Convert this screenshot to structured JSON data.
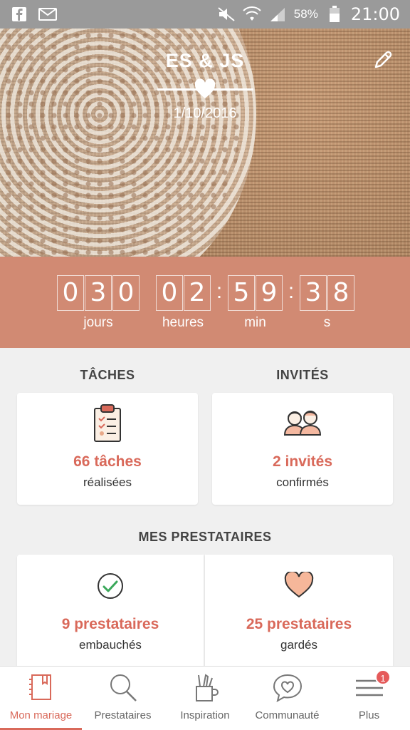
{
  "status_bar": {
    "battery_percent": "58%",
    "time": "21:00"
  },
  "header": {
    "couple_names": "ES & JS",
    "wedding_date": "1/10/2016"
  },
  "countdown": {
    "days_digits": [
      "0",
      "3",
      "0"
    ],
    "hours_digits": [
      "0",
      "2"
    ],
    "minutes_digits": [
      "5",
      "9"
    ],
    "seconds_digits": [
      "3",
      "8"
    ],
    "separator": ":",
    "labels": {
      "days": "jours",
      "hours": "heures",
      "minutes": "min",
      "seconds": "s"
    }
  },
  "tasks": {
    "title": "TÂCHES",
    "value": "66 tâches",
    "sub": "réalisées"
  },
  "guests": {
    "title": "INVITÉS",
    "value": "2 invités",
    "sub": "confirmés"
  },
  "vendors": {
    "title": "MES PRESTATAIRES",
    "hired": {
      "value": "9 prestataires",
      "sub": "embauchés"
    },
    "saved": {
      "value": "25 prestataires",
      "sub": "gardés"
    }
  },
  "bottom_nav": {
    "items": [
      {
        "label": "Mon mariage",
        "icon": "notebook-icon",
        "active": true
      },
      {
        "label": "Prestataires",
        "icon": "search-icon"
      },
      {
        "label": "Inspiration",
        "icon": "pencil-cup-icon"
      },
      {
        "label": "Communauté",
        "icon": "chat-heart-icon"
      },
      {
        "label": "Plus",
        "icon": "menu-icon",
        "badge": "1"
      }
    ]
  },
  "colors": {
    "accent": "#d9695a",
    "countdown_bg": "#d18a73",
    "status_bar": "#9a9a9a"
  }
}
